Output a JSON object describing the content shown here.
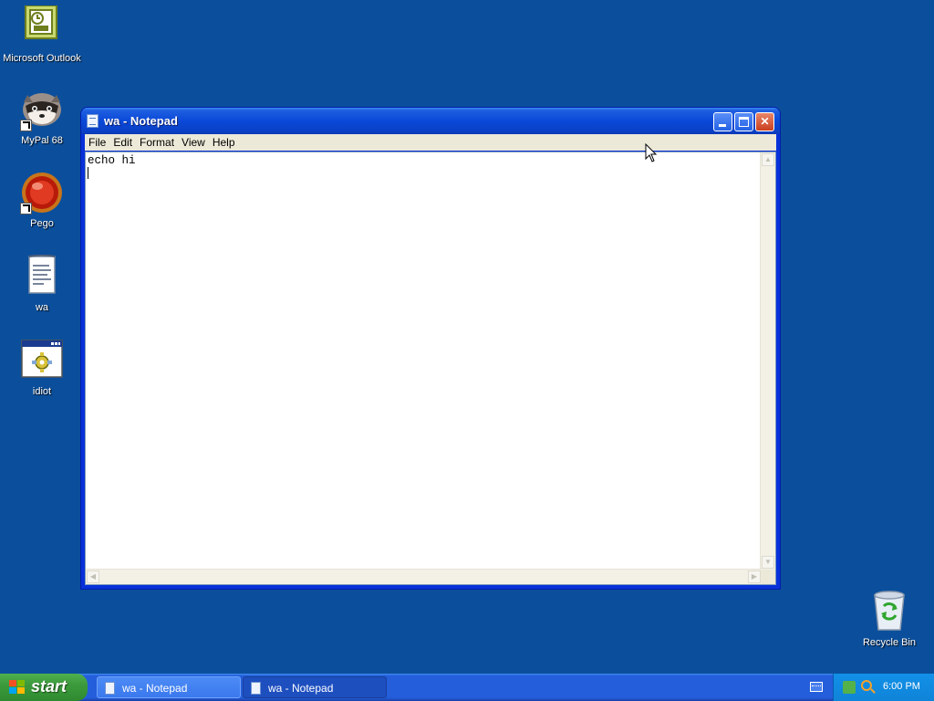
{
  "desktop": {
    "icons": [
      {
        "label": "Microsoft Outlook"
      },
      {
        "label": "MyPal 68"
      },
      {
        "label": "Pego"
      },
      {
        "label": "wa"
      },
      {
        "label": "idiot"
      },
      {
        "label": "Recycle Bin"
      }
    ]
  },
  "window": {
    "title": "wa - Notepad",
    "menu": [
      "File",
      "Edit",
      "Format",
      "View",
      "Help"
    ],
    "content": "echo hi"
  },
  "taskbar": {
    "start_label": "start",
    "buttons": [
      {
        "label": "wa - Notepad"
      },
      {
        "label": "wa - Notepad"
      }
    ],
    "clock": "6:00 PM"
  },
  "colors": {
    "desktop": "#0b4f9c",
    "titlebar": "#0a49d8",
    "start": "#3c9a3c"
  }
}
